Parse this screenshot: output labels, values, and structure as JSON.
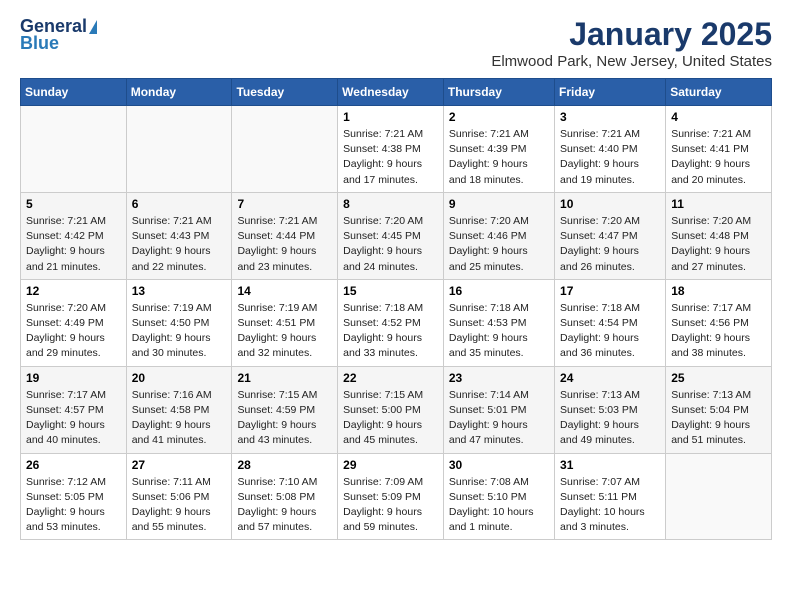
{
  "logo": {
    "general": "General",
    "blue": "Blue"
  },
  "title": {
    "month": "January 2025",
    "location": "Elmwood Park, New Jersey, United States"
  },
  "days_of_week": [
    "Sunday",
    "Monday",
    "Tuesday",
    "Wednesday",
    "Thursday",
    "Friday",
    "Saturday"
  ],
  "weeks": [
    [
      {
        "day": "",
        "info": ""
      },
      {
        "day": "",
        "info": ""
      },
      {
        "day": "",
        "info": ""
      },
      {
        "day": "1",
        "info": "Sunrise: 7:21 AM\nSunset: 4:38 PM\nDaylight: 9 hours\nand 17 minutes."
      },
      {
        "day": "2",
        "info": "Sunrise: 7:21 AM\nSunset: 4:39 PM\nDaylight: 9 hours\nand 18 minutes."
      },
      {
        "day": "3",
        "info": "Sunrise: 7:21 AM\nSunset: 4:40 PM\nDaylight: 9 hours\nand 19 minutes."
      },
      {
        "day": "4",
        "info": "Sunrise: 7:21 AM\nSunset: 4:41 PM\nDaylight: 9 hours\nand 20 minutes."
      }
    ],
    [
      {
        "day": "5",
        "info": "Sunrise: 7:21 AM\nSunset: 4:42 PM\nDaylight: 9 hours\nand 21 minutes."
      },
      {
        "day": "6",
        "info": "Sunrise: 7:21 AM\nSunset: 4:43 PM\nDaylight: 9 hours\nand 22 minutes."
      },
      {
        "day": "7",
        "info": "Sunrise: 7:21 AM\nSunset: 4:44 PM\nDaylight: 9 hours\nand 23 minutes."
      },
      {
        "day": "8",
        "info": "Sunrise: 7:20 AM\nSunset: 4:45 PM\nDaylight: 9 hours\nand 24 minutes."
      },
      {
        "day": "9",
        "info": "Sunrise: 7:20 AM\nSunset: 4:46 PM\nDaylight: 9 hours\nand 25 minutes."
      },
      {
        "day": "10",
        "info": "Sunrise: 7:20 AM\nSunset: 4:47 PM\nDaylight: 9 hours\nand 26 minutes."
      },
      {
        "day": "11",
        "info": "Sunrise: 7:20 AM\nSunset: 4:48 PM\nDaylight: 9 hours\nand 27 minutes."
      }
    ],
    [
      {
        "day": "12",
        "info": "Sunrise: 7:20 AM\nSunset: 4:49 PM\nDaylight: 9 hours\nand 29 minutes."
      },
      {
        "day": "13",
        "info": "Sunrise: 7:19 AM\nSunset: 4:50 PM\nDaylight: 9 hours\nand 30 minutes."
      },
      {
        "day": "14",
        "info": "Sunrise: 7:19 AM\nSunset: 4:51 PM\nDaylight: 9 hours\nand 32 minutes."
      },
      {
        "day": "15",
        "info": "Sunrise: 7:18 AM\nSunset: 4:52 PM\nDaylight: 9 hours\nand 33 minutes."
      },
      {
        "day": "16",
        "info": "Sunrise: 7:18 AM\nSunset: 4:53 PM\nDaylight: 9 hours\nand 35 minutes."
      },
      {
        "day": "17",
        "info": "Sunrise: 7:18 AM\nSunset: 4:54 PM\nDaylight: 9 hours\nand 36 minutes."
      },
      {
        "day": "18",
        "info": "Sunrise: 7:17 AM\nSunset: 4:56 PM\nDaylight: 9 hours\nand 38 minutes."
      }
    ],
    [
      {
        "day": "19",
        "info": "Sunrise: 7:17 AM\nSunset: 4:57 PM\nDaylight: 9 hours\nand 40 minutes."
      },
      {
        "day": "20",
        "info": "Sunrise: 7:16 AM\nSunset: 4:58 PM\nDaylight: 9 hours\nand 41 minutes."
      },
      {
        "day": "21",
        "info": "Sunrise: 7:15 AM\nSunset: 4:59 PM\nDaylight: 9 hours\nand 43 minutes."
      },
      {
        "day": "22",
        "info": "Sunrise: 7:15 AM\nSunset: 5:00 PM\nDaylight: 9 hours\nand 45 minutes."
      },
      {
        "day": "23",
        "info": "Sunrise: 7:14 AM\nSunset: 5:01 PM\nDaylight: 9 hours\nand 47 minutes."
      },
      {
        "day": "24",
        "info": "Sunrise: 7:13 AM\nSunset: 5:03 PM\nDaylight: 9 hours\nand 49 minutes."
      },
      {
        "day": "25",
        "info": "Sunrise: 7:13 AM\nSunset: 5:04 PM\nDaylight: 9 hours\nand 51 minutes."
      }
    ],
    [
      {
        "day": "26",
        "info": "Sunrise: 7:12 AM\nSunset: 5:05 PM\nDaylight: 9 hours\nand 53 minutes."
      },
      {
        "day": "27",
        "info": "Sunrise: 7:11 AM\nSunset: 5:06 PM\nDaylight: 9 hours\nand 55 minutes."
      },
      {
        "day": "28",
        "info": "Sunrise: 7:10 AM\nSunset: 5:08 PM\nDaylight: 9 hours\nand 57 minutes."
      },
      {
        "day": "29",
        "info": "Sunrise: 7:09 AM\nSunset: 5:09 PM\nDaylight: 9 hours\nand 59 minutes."
      },
      {
        "day": "30",
        "info": "Sunrise: 7:08 AM\nSunset: 5:10 PM\nDaylight: 10 hours\nand 1 minute."
      },
      {
        "day": "31",
        "info": "Sunrise: 7:07 AM\nSunset: 5:11 PM\nDaylight: 10 hours\nand 3 minutes."
      },
      {
        "day": "",
        "info": ""
      }
    ]
  ]
}
